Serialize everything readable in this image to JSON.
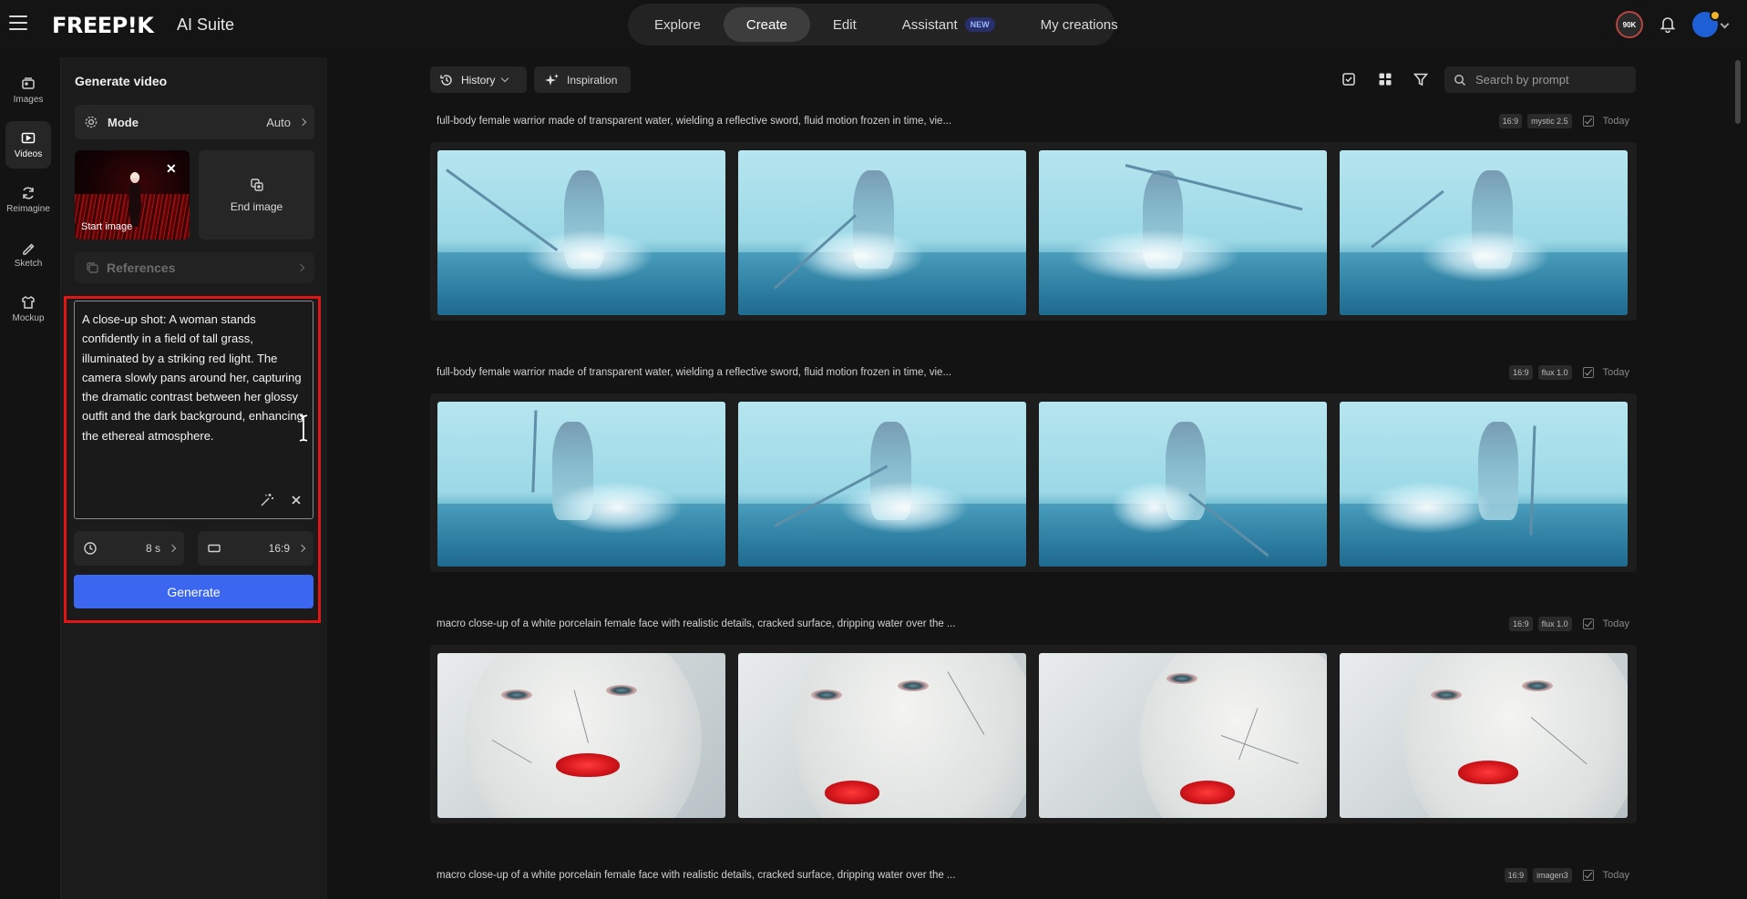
{
  "header": {
    "logo": "FREEP!K",
    "suite": "AI Suite",
    "nav": [
      {
        "label": "Explore",
        "active": false
      },
      {
        "label": "Create",
        "active": true
      },
      {
        "label": "Edit",
        "active": false
      },
      {
        "label": "Assistant",
        "active": false,
        "badge": "NEW"
      },
      {
        "label": "My creations",
        "active": false
      }
    ],
    "credits": "90K"
  },
  "rail": [
    {
      "label": "Images",
      "icon": "images-icon",
      "active": false
    },
    {
      "label": "Videos",
      "icon": "videos-icon",
      "active": true
    },
    {
      "label": "Reimagine",
      "icon": "reimagine-icon",
      "active": false
    },
    {
      "label": "Sketch",
      "icon": "sketch-icon",
      "active": false
    },
    {
      "label": "Mockup",
      "icon": "mockup-icon",
      "active": false
    }
  ],
  "panel": {
    "title": "Generate video",
    "mode_label": "Mode",
    "mode_value": "Auto",
    "start_image_label": "Start image",
    "end_image_label": "End image",
    "references_label": "References",
    "prompt": "A close-up shot: A woman stands confidently in a field of tall grass, illuminated by a striking red light. The camera slowly pans around her, capturing the dramatic contrast between her glossy outfit and the dark background, enhancing the ethereal atmosphere.",
    "duration": "8 s",
    "aspect": "16:9",
    "generate_label": "Generate"
  },
  "toolbar": {
    "history_label": "History",
    "inspiration_label": "Inspiration",
    "search_placeholder": "Search by prompt"
  },
  "generations": [
    {
      "prompt": "full-body female warrior made of transparent water, wielding a reflective sword, fluid motion frozen in time, vie...",
      "ratio": "16:9",
      "model": "mystic 2.5",
      "date": "Today",
      "kind": "water"
    },
    {
      "prompt": "full-body female warrior made of transparent water, wielding a reflective sword, fluid motion frozen in time, vie...",
      "ratio": "16:9",
      "model": "flux 1.0",
      "date": "Today",
      "kind": "water"
    },
    {
      "prompt": "macro close-up of a white porcelain female face with realistic details, cracked surface, dripping water over the ...",
      "ratio": "16:9",
      "model": "flux 1.0",
      "date": "Today",
      "kind": "face"
    },
    {
      "prompt": "macro close-up of a white porcelain female face with realistic details, cracked surface, dripping water over the ...",
      "ratio": "16:9",
      "model": "imagen3",
      "date": "Today",
      "kind": "face"
    }
  ],
  "colors": {
    "accent": "#3a66f0",
    "highlight": "#e01616",
    "background": "#131313",
    "panel": "#1b1b1b"
  }
}
